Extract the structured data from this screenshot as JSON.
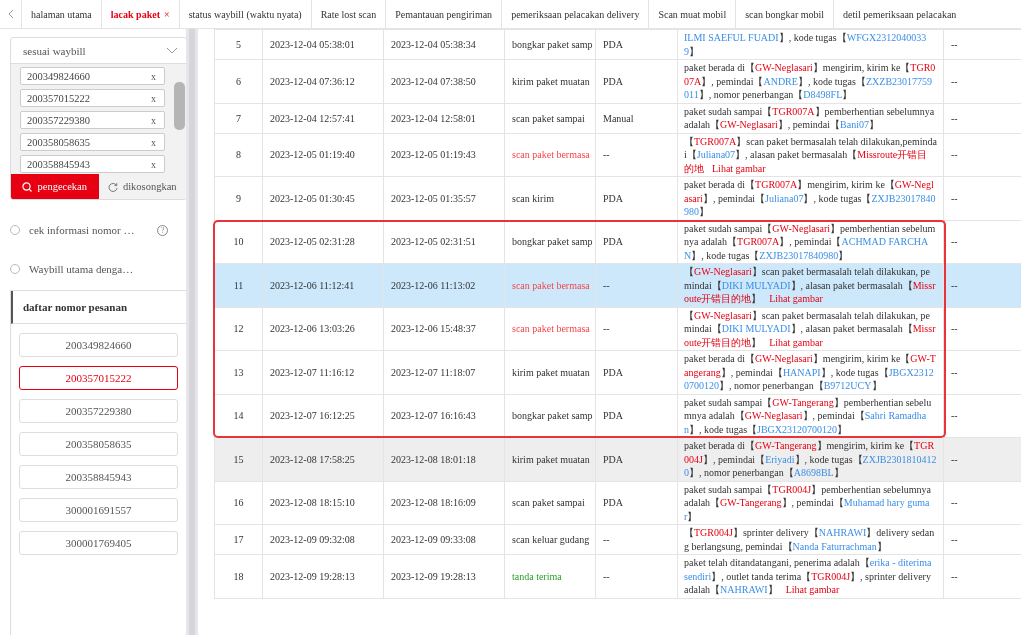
{
  "tabs": [
    {
      "label": "halaman utama",
      "selected": false
    },
    {
      "label": "lacak paket",
      "selected": true,
      "close": "×"
    },
    {
      "label": "status waybill (waktu nyata)",
      "selected": false
    },
    {
      "label": "Rate lost scan",
      "selected": false
    },
    {
      "label": "Pemantauan pengiriman",
      "selected": false
    },
    {
      "label": "pemeriksaan pelacakan delivery",
      "selected": false
    },
    {
      "label": "Scan muat mobil",
      "selected": false
    },
    {
      "label": "scan bongkar mobil",
      "selected": false
    },
    {
      "label": "detil pemeriksaan pelacakan",
      "selected": false
    }
  ],
  "search_panel": {
    "mode": "sesuai waybill",
    "waybills": [
      {
        "number": "200349824660",
        "remove": "x"
      },
      {
        "number": "200357015222",
        "remove": "x"
      },
      {
        "number": "200357229380",
        "remove": "x"
      },
      {
        "number": "200358058635",
        "remove": "x"
      },
      {
        "number": "200358845943",
        "remove": "x"
      }
    ],
    "buttons": [
      {
        "label": "pengecekan",
        "kind": "search"
      },
      {
        "label": "dikosongkan",
        "kind": "reset"
      }
    ]
  },
  "options": [
    {
      "label": "cek informasi nomor …",
      "selected": false,
      "help": "?"
    },
    {
      "label": "Waybill utama denga…",
      "selected": false
    }
  ],
  "order_list": {
    "title": "daftar nomor pesanan",
    "items": [
      {
        "number": "200349824660",
        "selected": false
      },
      {
        "number": "200357015222",
        "selected": true
      },
      {
        "number": "200357229380",
        "selected": false
      },
      {
        "number": "200358058635",
        "selected": false
      },
      {
        "number": "200358845943",
        "selected": false
      },
      {
        "number": "300001691557",
        "selected": false
      },
      {
        "number": "300001769405",
        "selected": false
      }
    ]
  },
  "table": {
    "rows": [
      {
        "no": "5",
        "scan_time": "2023-12-04 05:38:01",
        "upload_time": "2023-12-04 05:38:34",
        "type": "bongkar paket samp",
        "kind": "normal",
        "source": "PDA",
        "extra": "--",
        "selected": false,
        "hovered": false,
        "framed": false,
        "description": [
          {
            "kind": "person",
            "text": "ILMI SAEFUL FUADI"
          },
          {
            "kind": "plain",
            "text": "】, kode tugas【"
          },
          {
            "kind": "person",
            "text": "WFGX23120400339"
          },
          {
            "kind": "plain",
            "text": "】"
          }
        ]
      },
      {
        "no": "6",
        "scan_time": "2023-12-04 07:36:12",
        "upload_time": "2023-12-04 07:38:50",
        "type": "kirim paket muatan",
        "kind": "normal",
        "source": "PDA",
        "extra": "--",
        "selected": false,
        "hovered": false,
        "framed": false,
        "description": [
          {
            "kind": "plain",
            "text": "paket berada di【"
          },
          {
            "kind": "site",
            "text": "GW-Neglasari"
          },
          {
            "kind": "plain",
            "text": "】mengirim, kirim ke【"
          },
          {
            "kind": "site",
            "text": "TGR007A"
          },
          {
            "kind": "plain",
            "text": "】, pemindai【"
          },
          {
            "kind": "person",
            "text": "ANDRE"
          },
          {
            "kind": "plain",
            "text": "】, kode tugas【"
          },
          {
            "kind": "person",
            "text": "ZXZB23017759011"
          },
          {
            "kind": "plain",
            "text": "】, nomor penerbangan【"
          },
          {
            "kind": "person",
            "text": "D8498FL"
          },
          {
            "kind": "plain",
            "text": "】"
          }
        ]
      },
      {
        "no": "7",
        "scan_time": "2023-12-04 12:57:41",
        "upload_time": "2023-12-04 12:58:01",
        "type": "scan paket sampai",
        "kind": "normal",
        "source": "Manual",
        "extra": "--",
        "selected": false,
        "hovered": false,
        "framed": false,
        "description": [
          {
            "kind": "plain",
            "text": "paket sudah sampai【"
          },
          {
            "kind": "site",
            "text": "TGR007A"
          },
          {
            "kind": "plain",
            "text": "】pemberhentian sebelumnya adalah【"
          },
          {
            "kind": "site",
            "text": "GW-Neglasari"
          },
          {
            "kind": "plain",
            "text": "】, pemindai【"
          },
          {
            "kind": "person",
            "text": "Bani07"
          },
          {
            "kind": "plain",
            "text": "】"
          }
        ]
      },
      {
        "no": "8",
        "scan_time": "2023-12-05 01:19:40",
        "upload_time": "2023-12-05 01:19:43",
        "type": "scan paket bermasa",
        "kind": "problem",
        "source": "--",
        "extra": "--",
        "selected": false,
        "hovered": false,
        "framed": false,
        "description": [
          {
            "kind": "plain",
            "text": "【"
          },
          {
            "kind": "site",
            "text": "TGR007A"
          },
          {
            "kind": "plain",
            "text": "】scan paket bermasalah telah dilakukan,pemindai【"
          },
          {
            "kind": "person",
            "text": "Juliana07"
          },
          {
            "kind": "plain",
            "text": "】, alasan paket bermasalah【"
          },
          {
            "kind": "site",
            "text": "Missroute开错目的地"
          },
          {
            "kind": "link",
            "text": "Lihat gambar"
          }
        ]
      },
      {
        "no": "9",
        "scan_time": "2023-12-05 01:30:45",
        "upload_time": "2023-12-05 01:35:57",
        "type": "scan kirim",
        "kind": "normal",
        "source": "PDA",
        "extra": "--",
        "selected": false,
        "hovered": false,
        "framed": false,
        "description": [
          {
            "kind": "plain",
            "text": "paket berada di【"
          },
          {
            "kind": "site",
            "text": "TGR007A"
          },
          {
            "kind": "plain",
            "text": "】mengirim, kirim ke【"
          },
          {
            "kind": "site",
            "text": "GW-Neglasari"
          },
          {
            "kind": "plain",
            "text": "】, pemindai【"
          },
          {
            "kind": "person",
            "text": "Juliana07"
          },
          {
            "kind": "plain",
            "text": "】, kode tugas【"
          },
          {
            "kind": "person",
            "text": "ZXJB23017840980"
          },
          {
            "kind": "plain",
            "text": "】"
          }
        ]
      },
      {
        "no": "10",
        "scan_time": "2023-12-05 02:31:28",
        "upload_time": "2023-12-05 02:31:51",
        "type": "bongkar paket samp",
        "kind": "normal",
        "source": "PDA",
        "extra": "--",
        "selected": false,
        "hovered": false,
        "framed": true,
        "description": [
          {
            "kind": "plain",
            "text": "paket sudah sampai【"
          },
          {
            "kind": "site",
            "text": "GW-Neglasari"
          },
          {
            "kind": "plain",
            "text": "】pemberhentian sebelumnya adalah【"
          },
          {
            "kind": "site",
            "text": "TGR007A"
          },
          {
            "kind": "plain",
            "text": "】, pemindai【"
          },
          {
            "kind": "person",
            "text": "ACHMAD FARCHAN"
          },
          {
            "kind": "plain",
            "text": "】, kode tugas【"
          },
          {
            "kind": "person",
            "text": "ZXJB23017840980"
          },
          {
            "kind": "plain",
            "text": "】"
          }
        ]
      },
      {
        "no": "11",
        "scan_time": "2023-12-06 11:12:41",
        "upload_time": "2023-12-06 11:13:02",
        "type": "scan paket bermasa",
        "kind": "problem",
        "source": "--",
        "extra": "--",
        "selected": true,
        "hovered": false,
        "framed": true,
        "description": [
          {
            "kind": "plain",
            "text": "【"
          },
          {
            "kind": "site",
            "text": "GW-Neglasari"
          },
          {
            "kind": "plain",
            "text": "】scan paket bermasalah telah dilakukan, pemindai【"
          },
          {
            "kind": "person",
            "text": "DIKI MULYADI"
          },
          {
            "kind": "plain",
            "text": "】, alasan paket bermasalah【"
          },
          {
            "kind": "site",
            "text": "Missroute开错目的地"
          },
          {
            "kind": "plain",
            "text": "】"
          },
          {
            "kind": "link",
            "text": "Lihat gambar"
          }
        ]
      },
      {
        "no": "12",
        "scan_time": "2023-12-06 13:03:26",
        "upload_time": "2023-12-06 15:48:37",
        "type": "scan paket bermasa",
        "kind": "problem",
        "source": "--",
        "extra": "--",
        "selected": false,
        "hovered": false,
        "framed": true,
        "description": [
          {
            "kind": "plain",
            "text": "【"
          },
          {
            "kind": "site",
            "text": "GW-Neglasari"
          },
          {
            "kind": "plain",
            "text": "】scan paket bermasalah telah dilakukan, pemindai【"
          },
          {
            "kind": "person",
            "text": "DIKI MULYADI"
          },
          {
            "kind": "plain",
            "text": "】, alasan paket bermasalah【"
          },
          {
            "kind": "site",
            "text": "Missroute开错目的地"
          },
          {
            "kind": "plain",
            "text": "】"
          },
          {
            "kind": "link",
            "text": "Lihat gambar"
          }
        ]
      },
      {
        "no": "13",
        "scan_time": "2023-12-07 11:16:12",
        "upload_time": "2023-12-07 11:18:07",
        "type": "kirim paket muatan",
        "kind": "normal",
        "source": "PDA",
        "extra": "--",
        "selected": false,
        "hovered": false,
        "framed": true,
        "description": [
          {
            "kind": "plain",
            "text": "paket berada di【"
          },
          {
            "kind": "site",
            "text": "GW-Neglasari"
          },
          {
            "kind": "plain",
            "text": "】mengirim, kirim ke【"
          },
          {
            "kind": "site",
            "text": "GW-Tangerang"
          },
          {
            "kind": "plain",
            "text": "】, pemindai【"
          },
          {
            "kind": "person",
            "text": "HANAPI"
          },
          {
            "kind": "plain",
            "text": "】, kode tugas【"
          },
          {
            "kind": "person",
            "text": "JBGX23120700120"
          },
          {
            "kind": "plain",
            "text": "】, nomor penerbangan【"
          },
          {
            "kind": "person",
            "text": "B9712UCY"
          },
          {
            "kind": "plain",
            "text": "】"
          }
        ]
      },
      {
        "no": "14",
        "scan_time": "2023-12-07 16:12:25",
        "upload_time": "2023-12-07 16:16:43",
        "type": "bongkar paket samp",
        "kind": "normal",
        "source": "PDA",
        "extra": "--",
        "selected": false,
        "hovered": false,
        "framed": true,
        "description": [
          {
            "kind": "plain",
            "text": "paket sudah sampai【"
          },
          {
            "kind": "site",
            "text": "GW-Tangerang"
          },
          {
            "kind": "plain",
            "text": "】pemberhentian sebelumnya adalah【"
          },
          {
            "kind": "site",
            "text": "GW-Neglasari"
          },
          {
            "kind": "plain",
            "text": "】, pemindai【"
          },
          {
            "kind": "person",
            "text": "Sahri Ramadhan"
          },
          {
            "kind": "plain",
            "text": "】, kode tugas【"
          },
          {
            "kind": "person",
            "text": "JBGX23120700120"
          },
          {
            "kind": "plain",
            "text": "】"
          }
        ]
      },
      {
        "no": "15",
        "scan_time": "2023-12-08 17:58:25",
        "upload_time": "2023-12-08 18:01:18",
        "type": "kirim paket muatan",
        "kind": "normal",
        "source": "PDA",
        "extra": "--",
        "selected": false,
        "hovered": true,
        "framed": false,
        "description": [
          {
            "kind": "plain",
            "text": "paket berada di【"
          },
          {
            "kind": "site",
            "text": "GW-Tangerang"
          },
          {
            "kind": "plain",
            "text": "】mengirim, kirim ke【"
          },
          {
            "kind": "site",
            "text": "TGR004J"
          },
          {
            "kind": "plain",
            "text": "】, pemindai【"
          },
          {
            "kind": "person",
            "text": "Eriyadi"
          },
          {
            "kind": "plain",
            "text": "】, kode tugas【"
          },
          {
            "kind": "person",
            "text": "ZXJB23018104120"
          },
          {
            "kind": "plain",
            "text": "】, nomor penerbangan【"
          },
          {
            "kind": "person",
            "text": "A8698BL"
          },
          {
            "kind": "plain",
            "text": "】"
          }
        ]
      },
      {
        "no": "16",
        "scan_time": "2023-12-08 18:15:10",
        "upload_time": "2023-12-08 18:16:09",
        "type": "scan paket sampai",
        "kind": "normal",
        "source": "PDA",
        "extra": "--",
        "selected": false,
        "hovered": false,
        "framed": false,
        "description": [
          {
            "kind": "plain",
            "text": "paket sudah sampai【"
          },
          {
            "kind": "site",
            "text": "TGR004J"
          },
          {
            "kind": "plain",
            "text": "】pemberhentian sebelumnya adalah【"
          },
          {
            "kind": "site",
            "text": "GW-Tangerang"
          },
          {
            "kind": "plain",
            "text": "】, pemindai【"
          },
          {
            "kind": "person",
            "text": "Muhamad hary gumar"
          },
          {
            "kind": "plain",
            "text": "】"
          }
        ]
      },
      {
        "no": "17",
        "scan_time": "2023-12-09 09:32:08",
        "upload_time": "2023-12-09 09:33:08",
        "type": "scan keluar gudang",
        "kind": "normal",
        "source": "--",
        "extra": "--",
        "selected": false,
        "hovered": false,
        "framed": false,
        "description": [
          {
            "kind": "plain",
            "text": "【"
          },
          {
            "kind": "site",
            "text": "TGR004J"
          },
          {
            "kind": "plain",
            "text": "】sprinter delivery【"
          },
          {
            "kind": "person",
            "text": "NAHRAWI"
          },
          {
            "kind": "plain",
            "text": "】delivery sedang berlangsung, pemindai【"
          },
          {
            "kind": "person",
            "text": "Nanda Faturrachman"
          },
          {
            "kind": "plain",
            "text": "】"
          }
        ]
      },
      {
        "no": "18",
        "scan_time": "2023-12-09 19:28:13",
        "upload_time": "2023-12-09 19:28:13",
        "type": "tanda terima",
        "kind": "signed",
        "source": "--",
        "extra": "--",
        "selected": false,
        "hovered": false,
        "framed": false,
        "description": [
          {
            "kind": "plain",
            "text": "paket telah ditandatangani, penerima adalah【"
          },
          {
            "kind": "person",
            "text": "erika - diterima sendiri"
          },
          {
            "kind": "plain",
            "text": "】, outlet tanda terima【"
          },
          {
            "kind": "site",
            "text": "TGR004J"
          },
          {
            "kind": "plain",
            "text": "】, sprinter delivery adalah【"
          },
          {
            "kind": "person",
            "text": "NAHRAWI"
          },
          {
            "kind": "plain",
            "text": "】"
          },
          {
            "kind": "link",
            "text": "Lihat gambar"
          }
        ]
      }
    ]
  }
}
